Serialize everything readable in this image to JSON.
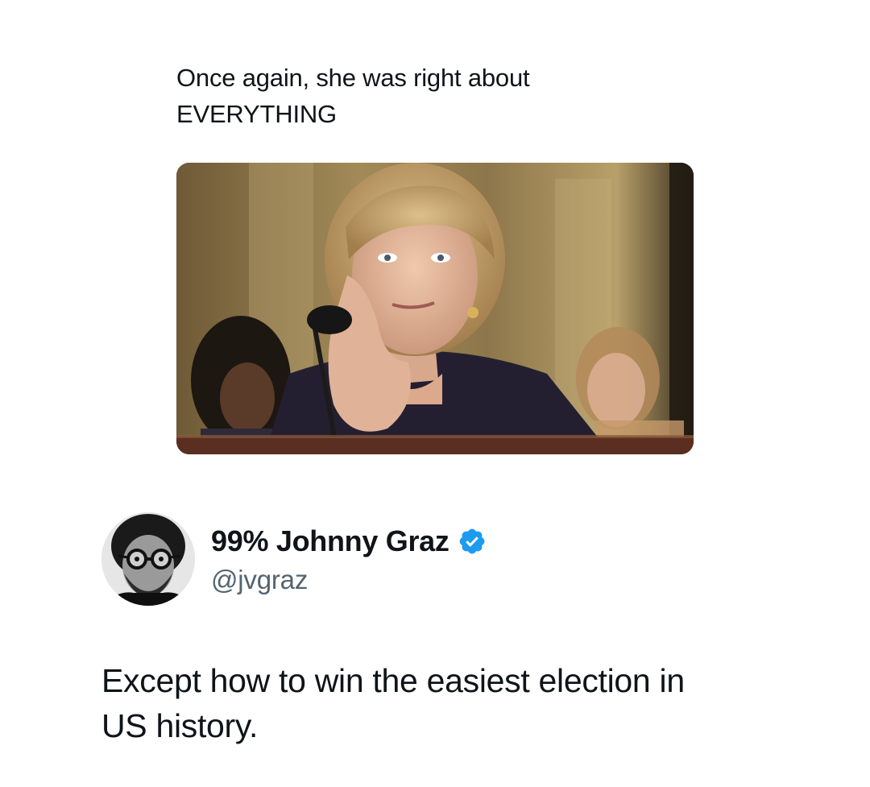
{
  "quoted_tweet": {
    "text_lines": [
      "Once again, she was right about",
      "EVERYTHING"
    ],
    "media": {
      "description_icon": "photo-image",
      "palette": {
        "background": "#7a6640",
        "wall_light": "#b29a66",
        "jacket": "#2a2436",
        "skin": "#e3b79a",
        "hair": "#c9a46a"
      }
    }
  },
  "reply": {
    "author": {
      "display_name": "99% Johnny Graz",
      "handle": "@jvgraz",
      "verified": true,
      "verified_color": "#1d9bf0"
    },
    "text_lines": [
      "Except how to win the easiest election in",
      "US history."
    ]
  }
}
